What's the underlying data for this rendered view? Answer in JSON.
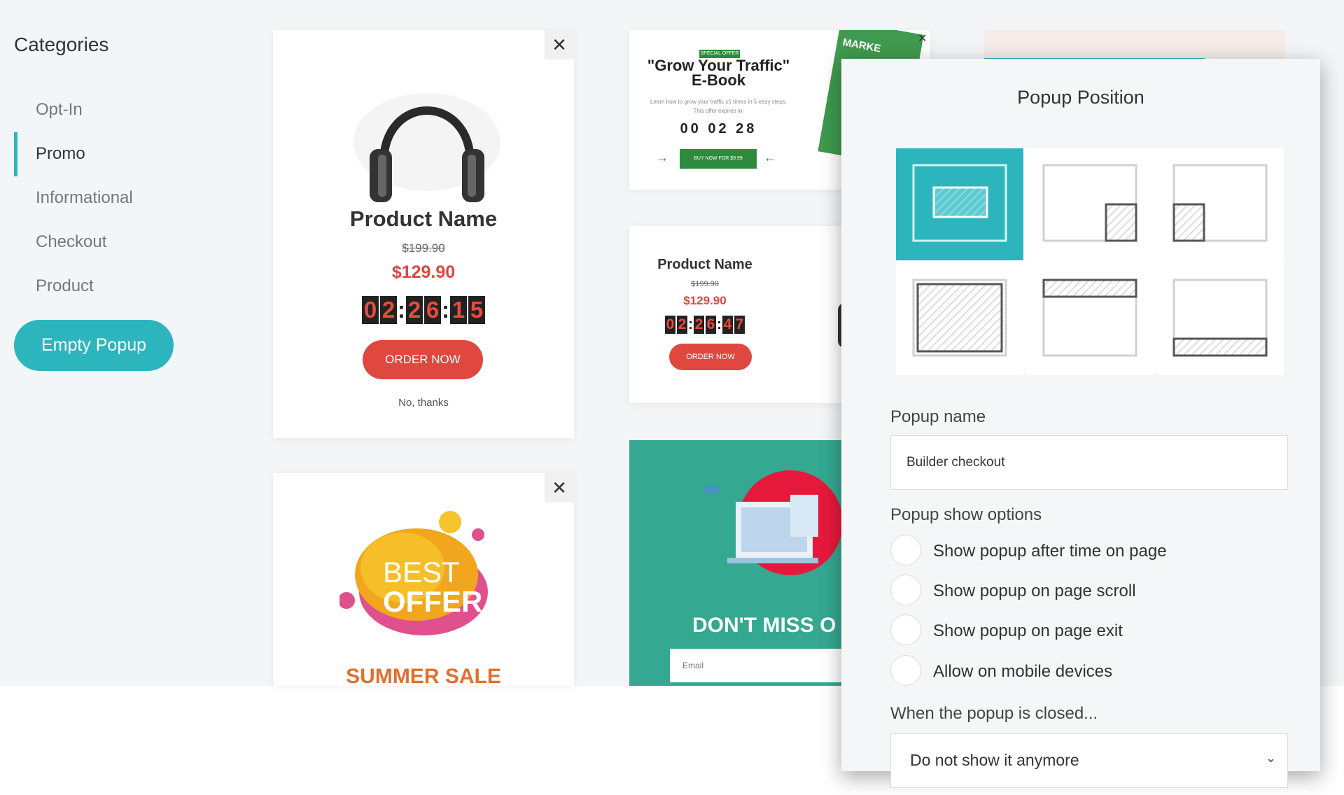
{
  "sidebar": {
    "title": "Categories",
    "items": [
      {
        "label": "Opt-In"
      },
      {
        "label": "Promo"
      },
      {
        "label": "Informational"
      },
      {
        "label": "Checkout"
      },
      {
        "label": "Product"
      }
    ],
    "active_item": "Promo",
    "empty_popup_label": "Empty Popup"
  },
  "templates": {
    "product_card": {
      "name": "Product Name",
      "old_price": "$199.90",
      "price": "$129.90",
      "timer": [
        "0",
        "2",
        "2",
        "6",
        "1",
        "5"
      ],
      "order_label": "ORDER NOW",
      "decline_label": "No, thanks",
      "close_icon": "close-icon"
    },
    "ebook_card": {
      "badge": "SPECIAL OFFER",
      "title_line1": "\"Grow Your Traffic\"",
      "title_line2": "E-Book",
      "desc_line1": "Learn how to grow your traffic x5 times in 5 easy steps.",
      "desc_line2": "This offer expires in:",
      "timer": "00 02 28",
      "button_label": "BUY NOW FOR $9.99",
      "book_text": "MARKE"
    },
    "product_card_small": {
      "name": "Product Name",
      "old_price": "$199.90",
      "price": "$129.90",
      "timer": [
        "0",
        "2",
        "2",
        "6",
        "4",
        "7"
      ],
      "order_label": "ORDER NOW"
    },
    "sale_card": {
      "best": "BEST",
      "offer": "OFFER",
      "sale": "SUMMER SALE"
    },
    "dont_miss_card": {
      "headline": "DON'T MISS O",
      "email_placeholder": "Email"
    }
  },
  "panel": {
    "title": "Popup Position",
    "positions": [
      {
        "name": "center",
        "selected": true
      },
      {
        "name": "bottom-right",
        "selected": false
      },
      {
        "name": "bottom-left",
        "selected": false
      },
      {
        "name": "fullscreen",
        "selected": false
      },
      {
        "name": "top-bar",
        "selected": false
      },
      {
        "name": "bottom-bar",
        "selected": false
      }
    ],
    "name_label": "Popup name",
    "name_value": "Builder checkout",
    "show_options_label": "Popup show options",
    "show_options": [
      {
        "label": "Show popup after time on page",
        "checked": false
      },
      {
        "label": "Show popup on page scroll",
        "checked": false
      },
      {
        "label": "Show popup on page exit",
        "checked": false
      },
      {
        "label": "Allow on mobile devices",
        "checked": false
      }
    ],
    "closed_label": "When the popup is closed...",
    "closed_value": "Do not show it anymore",
    "closed_icon": "chevron-down-icon"
  },
  "colors": {
    "accent": "#2cb5bd",
    "red": "#e0473f",
    "green": "#2e8b3e",
    "teal_bg": "#34a891"
  }
}
